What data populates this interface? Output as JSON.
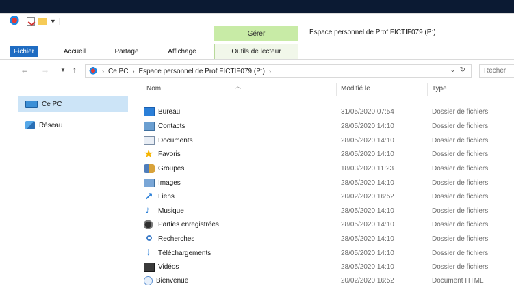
{
  "window": {
    "title": "Espace personnel de Prof FICTIF079 (P:)",
    "contextual_tab": "Gérer"
  },
  "ribbon": {
    "tabs": [
      {
        "label": "Fichier",
        "active": true
      },
      {
        "label": "Accueil"
      },
      {
        "label": "Partage"
      },
      {
        "label": "Affichage"
      },
      {
        "label": "Outils de lecteur"
      }
    ]
  },
  "address": {
    "path": [
      "Ce PC",
      "Espace personnel de Prof FICTIF079 (P:)"
    ],
    "search_placeholder": "Recher"
  },
  "sidebar": {
    "items": [
      {
        "label": "Ce PC",
        "icon": "computer-icon",
        "selected": true
      },
      {
        "label": "Réseau",
        "icon": "network-icon"
      }
    ]
  },
  "columns": {
    "name": "Nom",
    "modified": "Modifié le",
    "type": "Type"
  },
  "files": [
    {
      "name": "Bureau",
      "date": "31/05/2020 07:54",
      "type": "Dossier de fichiers",
      "icon": "desktop-folder-icon"
    },
    {
      "name": "Contacts",
      "date": "28/05/2020 14:10",
      "type": "Dossier de fichiers",
      "icon": "contacts-folder-icon"
    },
    {
      "name": "Documents",
      "date": "28/05/2020 14:10",
      "type": "Dossier de fichiers",
      "icon": "documents-folder-icon"
    },
    {
      "name": "Favoris",
      "date": "28/05/2020 14:10",
      "type": "Dossier de fichiers",
      "icon": "favorites-star-icon"
    },
    {
      "name": "Groupes",
      "date": "18/03/2020 11:23",
      "type": "Dossier de fichiers",
      "icon": "groups-folder-icon"
    },
    {
      "name": "Images",
      "date": "28/05/2020 14:10",
      "type": "Dossier de fichiers",
      "icon": "pictures-folder-icon"
    },
    {
      "name": "Liens",
      "date": "20/02/2020 16:52",
      "type": "Dossier de fichiers",
      "icon": "links-arrow-icon"
    },
    {
      "name": "Musique",
      "date": "28/05/2020 14:10",
      "type": "Dossier de fichiers",
      "icon": "music-note-icon"
    },
    {
      "name": "Parties enregistrées",
      "date": "28/05/2020 14:10",
      "type": "Dossier de fichiers",
      "icon": "saved-games-icon"
    },
    {
      "name": "Recherches",
      "date": "28/05/2020 14:10",
      "type": "Dossier de fichiers",
      "icon": "searches-icon"
    },
    {
      "name": "Téléchargements",
      "date": "28/05/2020 14:10",
      "type": "Dossier de fichiers",
      "icon": "downloads-arrow-icon"
    },
    {
      "name": "Vidéos",
      "date": "28/05/2020 14:10",
      "type": "Dossier de fichiers",
      "icon": "videos-folder-icon"
    },
    {
      "name": "Bienvenue",
      "date": "20/02/2020 16:52",
      "type": "Document HTML",
      "icon": "html-document-icon"
    }
  ],
  "colors": {
    "accent": "#1f6cc2",
    "manage_tab": "#c8eba6",
    "selection": "#cce4f7",
    "desktop_band": "#0b1a33"
  }
}
